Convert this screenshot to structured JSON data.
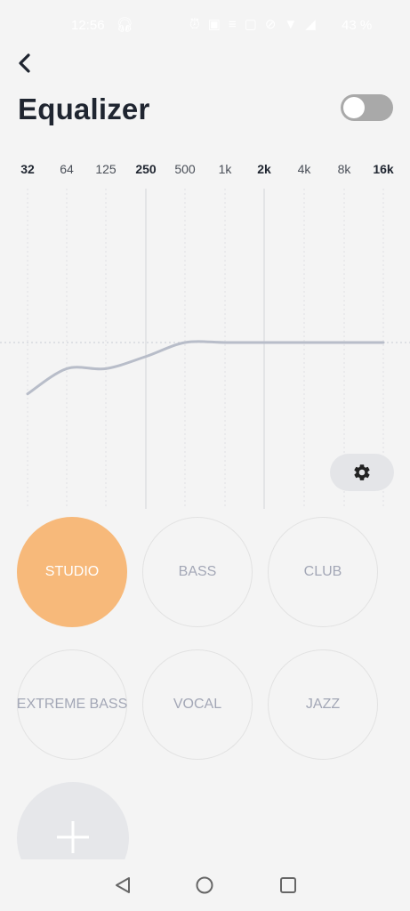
{
  "status_bar": {
    "time": "12:56",
    "battery": "43 %",
    "icons": [
      "headphones-icon",
      "alarm-icon",
      "nfc-icon",
      "vibrate-icon",
      "screenshot-icon",
      "mute-icon",
      "wifi-icon",
      "signal-icon",
      "battery-icon"
    ]
  },
  "header": {
    "title": "Equalizer",
    "toggle_on": false
  },
  "equalizer": {
    "bands": [
      "32",
      "64",
      "125",
      "250",
      "500",
      "1k",
      "2k",
      "4k",
      "8k",
      "16k"
    ],
    "bold_bands": [
      "32",
      "250",
      "2k",
      "16k"
    ],
    "gains_relative": [
      -0.55,
      -0.28,
      -0.28,
      -0.15,
      0,
      0,
      0,
      0,
      0,
      0
    ],
    "line_color": "#b8bdc9"
  },
  "presets": [
    {
      "label": "STUDIO",
      "active": true
    },
    {
      "label": "BASS",
      "active": false
    },
    {
      "label": "CLUB",
      "active": false
    },
    {
      "label": "EXTREME BASS",
      "active": false
    },
    {
      "label": "VOCAL",
      "active": false
    },
    {
      "label": "JAZZ",
      "active": false
    }
  ],
  "colors": {
    "accent": "#f7b97a",
    "title": "#1f2530",
    "toggle_off": "#a9a9a9"
  }
}
